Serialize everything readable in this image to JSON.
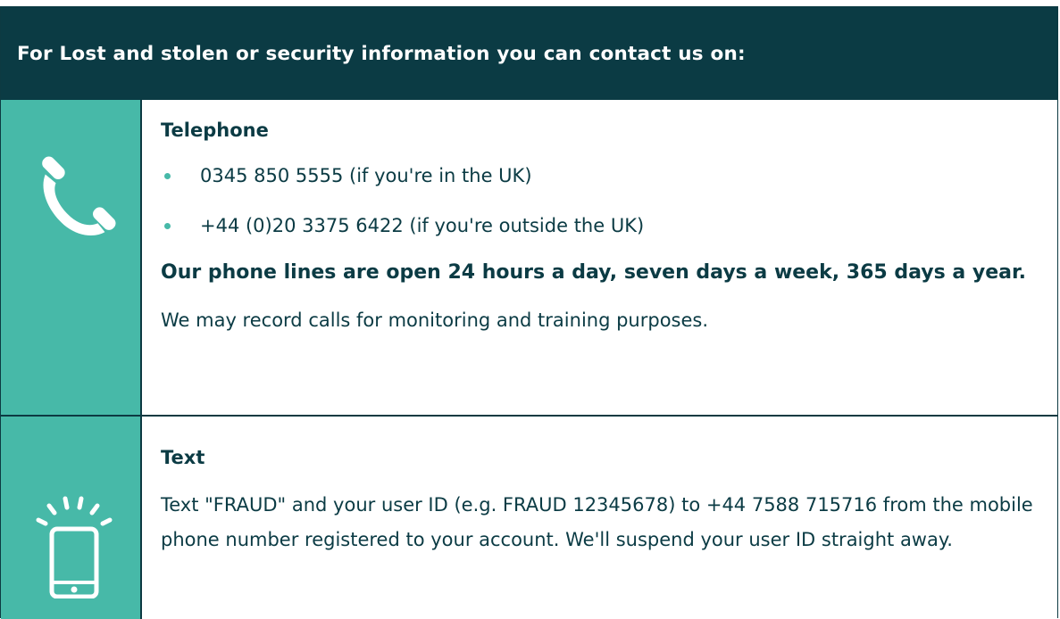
{
  "header": {
    "title": "For Lost and stolen or security information you can contact us on:"
  },
  "telephone": {
    "icon": "telephone-handset-icon",
    "title": "Telephone",
    "numbers": [
      "0345 850 5555 (if you're in the UK)",
      "+44 (0)20 3375 6422 (if you're outside the UK)"
    ],
    "hours_note": "Our phone lines are open 24 hours a day, seven days a week, 365 days a year.",
    "recording_note": "We may record calls for monitoring and training purposes."
  },
  "text": {
    "icon": "mobile-phone-icon",
    "title": "Text",
    "body": "Text \"FRAUD\" and your user ID (e.g. FRAUD 12345678) to +44 7588 715716 from the mobile phone number registered to your account. We'll suspend your user ID straight away."
  },
  "colors": {
    "header_bg": "#0b3b44",
    "icon_column_bg": "#47b9a8",
    "text": "#0b3b44",
    "bullet": "#47b9a8"
  }
}
